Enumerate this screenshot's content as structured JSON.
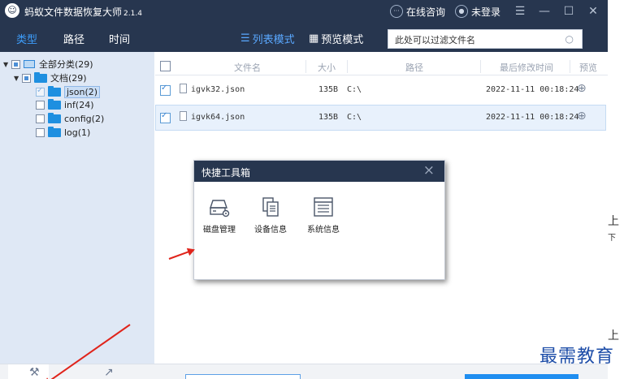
{
  "app": {
    "title": "蚂蚁文件数据恢复大师",
    "version": "2.1.4"
  },
  "titlebar": {
    "consult": "在线咨询",
    "login": "未登录",
    "menu_glyph": "☰",
    "min_glyph": "—",
    "max_glyph": "☐",
    "close_glyph": "✕"
  },
  "toolbar": {
    "tabs": [
      {
        "label": "类型",
        "active": true
      },
      {
        "label": "路径"
      },
      {
        "label": "时间"
      }
    ],
    "modes": [
      {
        "label": "列表模式",
        "active": true
      },
      {
        "label": "预览模式"
      }
    ]
  },
  "search": {
    "placeholder": "此处可以过滤文件名"
  },
  "tree": [
    {
      "label": "全部分类(29)",
      "expanded": true
    },
    {
      "label": "文档(29)",
      "expanded": true
    },
    {
      "label": "json(2)",
      "checked": true,
      "selected": true
    },
    {
      "label": "inf(24)",
      "checked": false
    },
    {
      "label": "config(2)",
      "checked": false
    },
    {
      "label": "log(1)",
      "checked": false
    }
  ],
  "columns": [
    "文件名",
    "大小",
    "路径",
    "最后修改时间",
    "预览"
  ],
  "files": [
    {
      "name": "igvk32.json",
      "size": "135B",
      "path": "C:\\",
      "modified": "2022-11-11 00:18:24",
      "checked": true
    },
    {
      "name": "igvk64.json",
      "size": "135B",
      "path": "C:\\",
      "modified": "2022-11-11 00:18:24",
      "checked": true
    }
  ],
  "dialog": {
    "title": "快捷工具箱",
    "tools": [
      {
        "label": "磁盘管理",
        "icon": "disk-manage-icon"
      },
      {
        "label": "设备信息",
        "icon": "device-info-icon"
      },
      {
        "label": "系统信息",
        "icon": "system-info-icon"
      }
    ]
  },
  "watermark": "最需教育",
  "colors": {
    "titlebar": "#27364f",
    "accent": "#3d9dfb",
    "sidebar": "#dfe8f5",
    "arrow": "#e0241b",
    "watermark": "#1d4da8"
  }
}
